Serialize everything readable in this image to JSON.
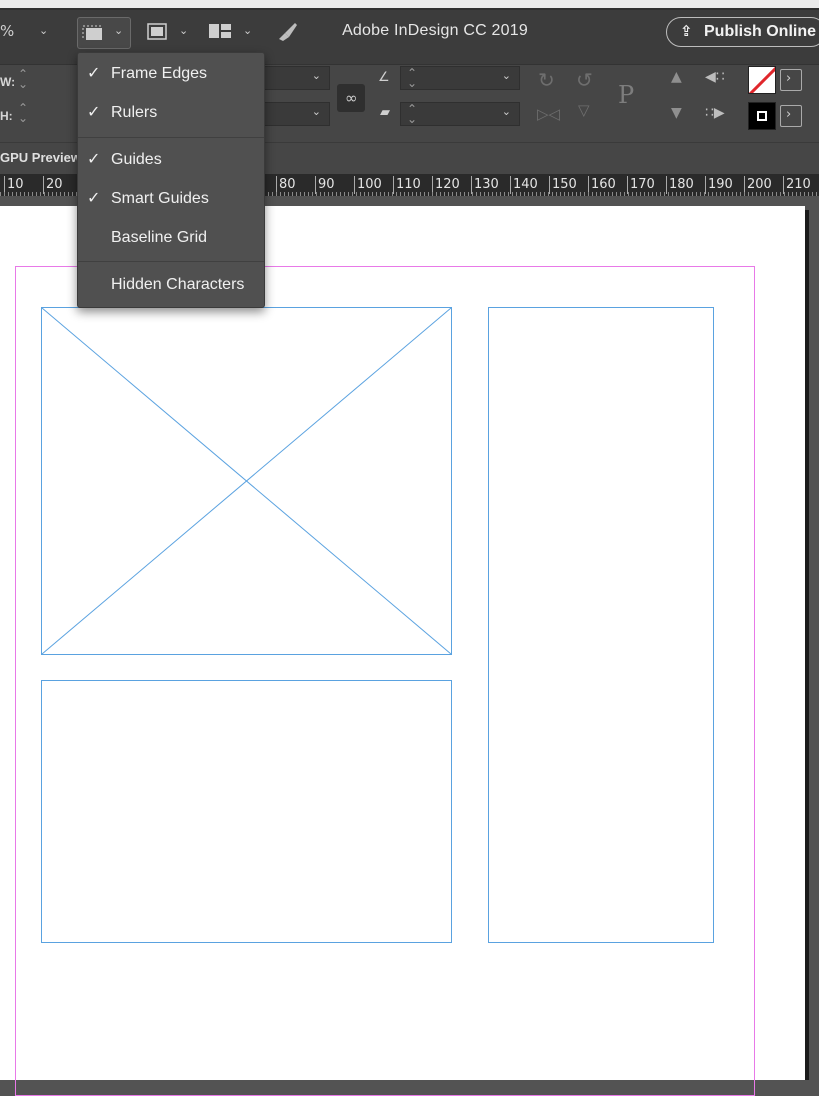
{
  "app": {
    "title": "Adobe InDesign CC 2019",
    "publish_label": "Publish Online",
    "zoom_suffix": "%"
  },
  "control": {
    "w_label": "W:",
    "h_label": "H:"
  },
  "gpu_preview_label": "GPU Preview",
  "ruler": {
    "ticks": [
      "10",
      "20",
      "80",
      "90",
      "100",
      "110",
      "120",
      "130",
      "140",
      "150",
      "160",
      "170",
      "180",
      "190",
      "200",
      "210"
    ]
  },
  "view_menu": {
    "items": [
      {
        "label": "Frame Edges",
        "checked": true
      },
      {
        "label": "Rulers",
        "checked": true
      },
      {
        "label": "Guides",
        "checked": true
      },
      {
        "label": "Smart Guides",
        "checked": true
      },
      {
        "label": "Baseline Grid",
        "checked": false
      },
      {
        "label": "Hidden Characters",
        "checked": false
      }
    ]
  },
  "colors": {
    "frame": "#5aa2e0",
    "margin_guide": "#e879e8",
    "menu_bg": "#505050"
  }
}
